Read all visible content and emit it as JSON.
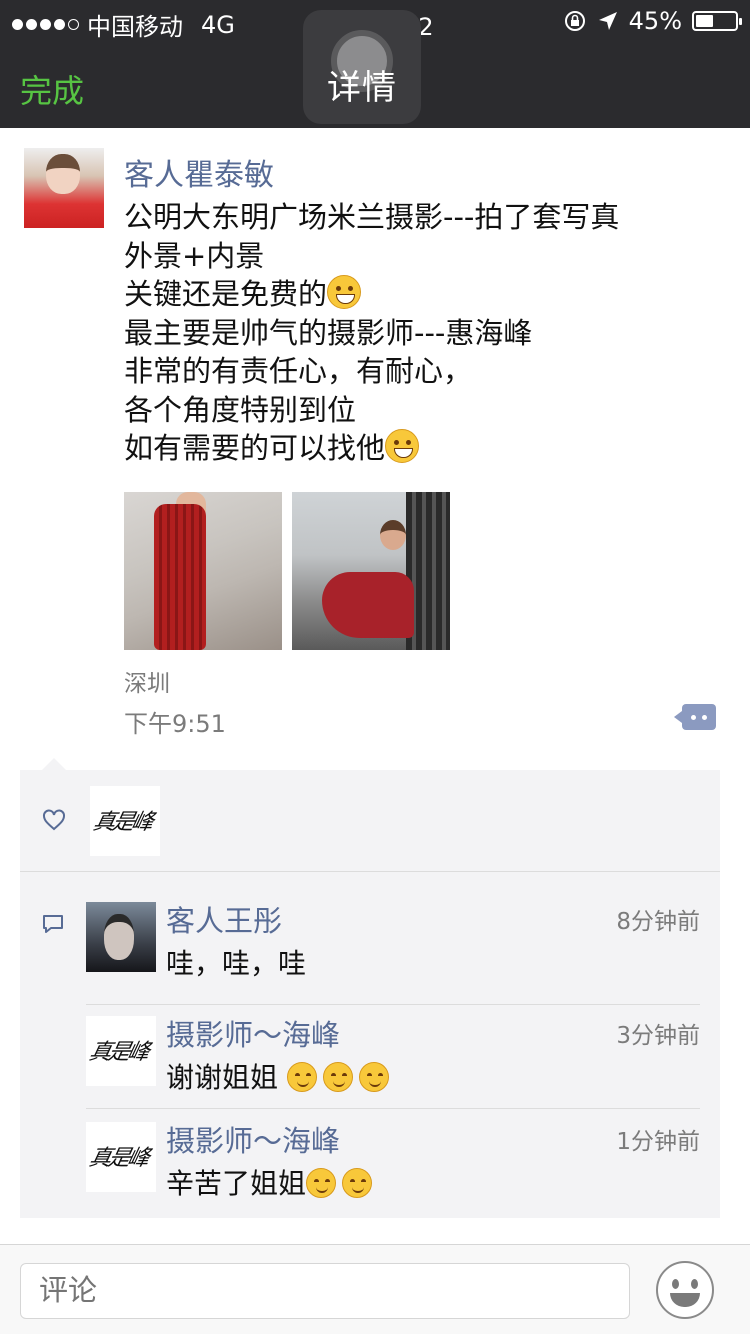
{
  "status_bar": {
    "carrier": "中国移动",
    "network": "4G",
    "time": "下午10:12",
    "battery_percent": "45%",
    "battery_level": 0.45
  },
  "nav": {
    "done_label": "完成",
    "title": "详情",
    "done_color": "#57c443"
  },
  "post": {
    "author": "客人瞿泰敏",
    "lines": [
      "公明大东明广场米兰摄影---拍了套写真",
      "外景+内景",
      "关键还是免费的",
      "最主要是帅气的摄影师---惠海峰",
      "非常的有责任心，有耐心，",
      "各个角度特别到位",
      "如有需要的可以找他"
    ],
    "location": "深圳",
    "time": "下午9:51",
    "name_color": "#576b95"
  },
  "likes": {
    "icon": "heart-icon"
  },
  "comments": [
    {
      "name": "客人王彤",
      "time": "8分钟前",
      "text": "哇，哇，哇"
    },
    {
      "name": "摄影师～海峰",
      "time": "3分钟前",
      "text": "谢谢姐姐"
    },
    {
      "name": "摄影师～海峰",
      "time": "1分钟前",
      "text": "辛苦了姐姐"
    }
  ],
  "input": {
    "placeholder": "评论"
  }
}
